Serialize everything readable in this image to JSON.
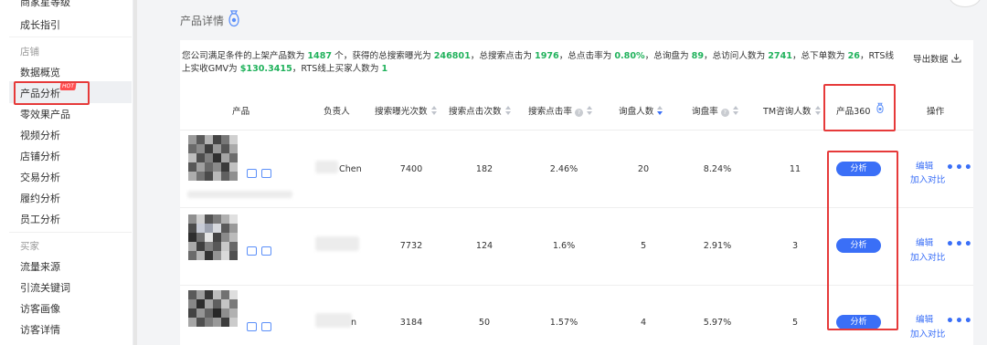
{
  "sidebar": {
    "top_item_partial": "商家星等级",
    "guide": "成长指引",
    "group_shop": "店铺",
    "items_shop": [
      "数据概览",
      "产品分析",
      "零效果产品",
      "视频分析",
      "店铺分析",
      "交易分析",
      "履约分析",
      "员工分析"
    ],
    "hot_badge": "HOT",
    "group_buyer": "买家",
    "items_buyer": [
      "流量来源",
      "引流关键词",
      "访客画像",
      "访客详情"
    ]
  },
  "main": {
    "title": "产品详情",
    "export_label": "导出数据",
    "summary": {
      "p1": "您公司满足条件的上架产品数为",
      "v1": "1487",
      "p2": "个，获得的总搜索曝光为",
      "v2": "246801",
      "p3": "，总搜索点击为",
      "v3": "1976",
      "p4": "，总点击率为",
      "v4": "0.80%",
      "p5": "，总询盘为",
      "v5": "89",
      "p6": "，总访问人数为",
      "v6": "2741",
      "p7": "，总下单数为",
      "v7": "26",
      "p8": "，RTS线上实收GMV为",
      "v8": "$130.3415",
      "p9": "，RTS线上买家人数为",
      "v9": "1"
    },
    "columns": {
      "product": "产品",
      "owner": "负责人",
      "impressions": "搜索曝光次数",
      "clicks": "搜索点击次数",
      "ctr": "搜索点击率",
      "inquiry_people": "询盘人数",
      "inquiry_rate": "询盘率",
      "tm_people": "TM咨询人数",
      "p360": "产品360",
      "ops": "操作"
    },
    "rows": [
      {
        "owner": "Chen",
        "impressions": "7400",
        "clicks": "182",
        "ctr": "2.46%",
        "inquiry_people": "20",
        "inquiry_rate": "8.24%",
        "tm_people": "11"
      },
      {
        "owner": "",
        "impressions": "7732",
        "clicks": "124",
        "ctr": "1.6%",
        "inquiry_people": "5",
        "inquiry_rate": "2.91%",
        "tm_people": "3"
      },
      {
        "owner": "n",
        "impressions": "3184",
        "clicks": "50",
        "ctr": "1.57%",
        "inquiry_people": "4",
        "inquiry_rate": "5.97%",
        "tm_people": "5"
      }
    ],
    "row_actions": {
      "analyze": "分析",
      "edit": "编辑",
      "compare": "加入对比",
      "more": "•••"
    }
  },
  "colors": {
    "accent": "#3a6ff7",
    "highlight_green": "#21b25c",
    "annotation_red": "#e63a3a",
    "hot": "#ff4d4f"
  }
}
